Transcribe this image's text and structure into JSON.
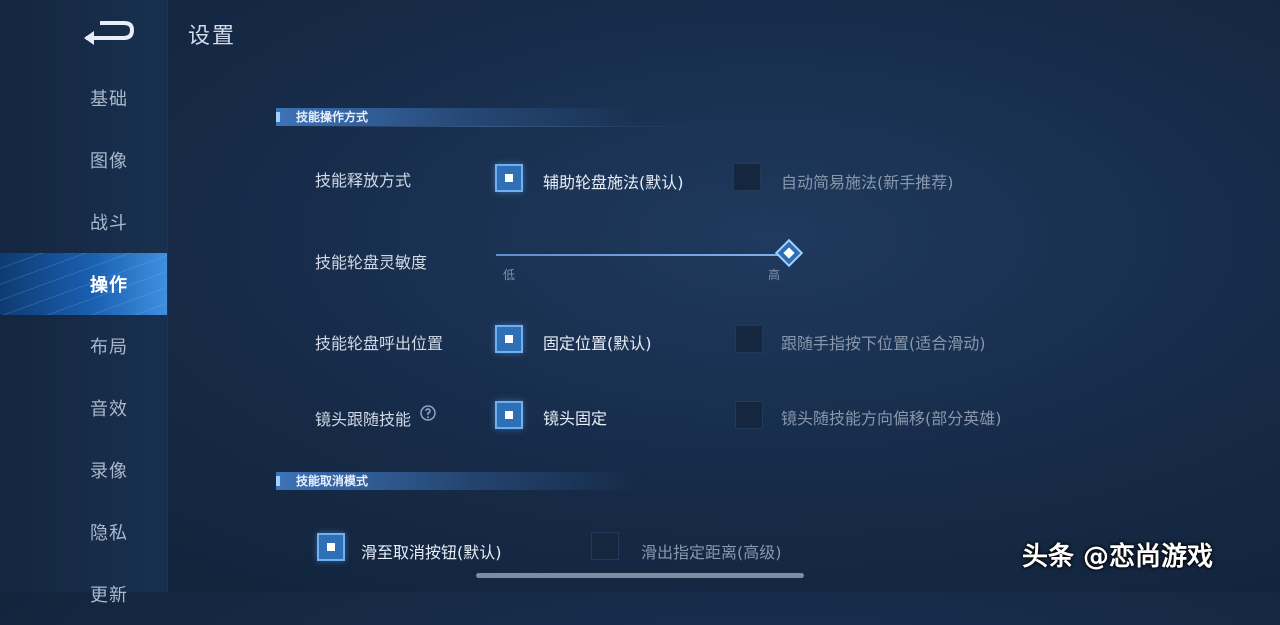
{
  "page_title": "设置",
  "sidebar": {
    "items": [
      {
        "label": "基础"
      },
      {
        "label": "图像"
      },
      {
        "label": "战斗"
      },
      {
        "label": "操作"
      },
      {
        "label": "布局"
      },
      {
        "label": "音效"
      },
      {
        "label": "录像"
      },
      {
        "label": "隐私"
      },
      {
        "label": "更新"
      }
    ],
    "active": "操作"
  },
  "sections": [
    {
      "title": "技能操作方式",
      "rows": [
        {
          "label": "技能释放方式",
          "options": [
            {
              "label": "辅助轮盘施法(默认)",
              "checked": true
            },
            {
              "label": "自动简易施法(新手推荐)",
              "checked": false
            }
          ]
        },
        {
          "label": "技能轮盘灵敏度",
          "slider": {
            "min_label": "低",
            "max_label": "高",
            "value": 1.0
          }
        },
        {
          "label": "技能轮盘呼出位置",
          "options": [
            {
              "label": "固定位置(默认)",
              "checked": true
            },
            {
              "label": "跟随手指按下位置(适合滑动)",
              "checked": false
            }
          ]
        },
        {
          "label": "镜头跟随技能",
          "options": [
            {
              "label": "镜头固定",
              "checked": true
            },
            {
              "label": "镜头随技能方向偏移(部分英雄)",
              "checked": false
            }
          ]
        }
      ]
    },
    {
      "title": "技能取消模式",
      "rows": [
        {
          "options": [
            {
              "label": "滑至取消按钮(默认)",
              "checked": true
            },
            {
              "label": "滑出指定距离(高级)",
              "checked": false
            }
          ]
        }
      ]
    }
  ],
  "watermark": "头条 @恋尚游戏"
}
